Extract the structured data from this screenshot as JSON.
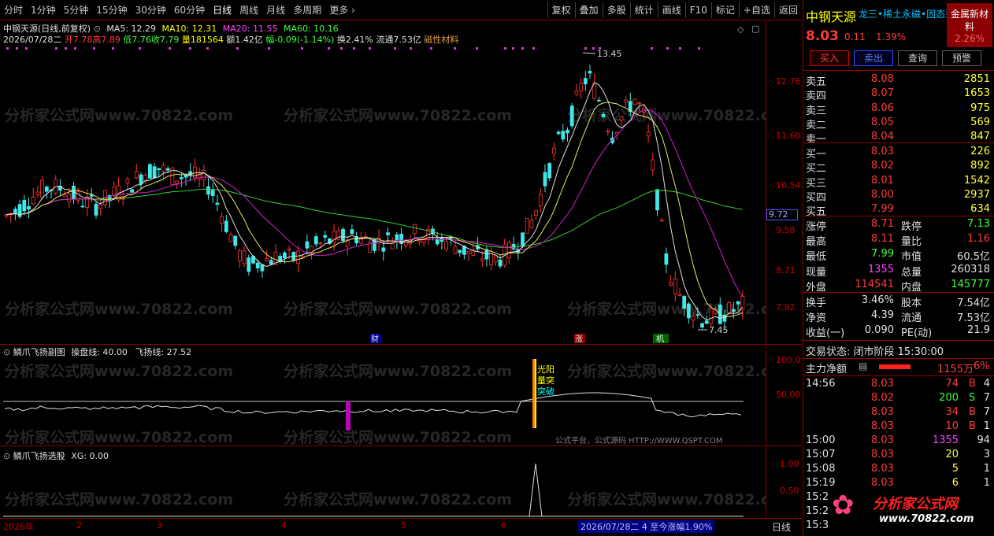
{
  "toolbar": {
    "periods": [
      "分时",
      "1分钟",
      "5分钟",
      "15分钟",
      "30分钟",
      "60分钟",
      "日线",
      "周线",
      "月线",
      "多周期",
      "更多"
    ],
    "active_period": "日线",
    "buttons": [
      "复权",
      "叠加",
      "多股",
      "统计",
      "画线",
      "F10",
      "标记",
      "+自选",
      "返回"
    ]
  },
  "main_chart": {
    "title": "中钢天源(日线,前复权)",
    "ma5": "MA5: 12.29",
    "ma10": "MA10: 12.31",
    "ma20": "MA20: 11.55",
    "ma60": "MA60: 10.16",
    "info_line": {
      "date": "2026/07/28二",
      "open": "开7.78",
      "high": "高7.89",
      "low": "低7.76",
      "close": "收7.79",
      "volume": "量181564",
      "amount": "额1.42亿",
      "change": "幅-0.09(-1.14%)",
      "turnover": "换2.41%",
      "float_cap": "流通7.53亿",
      "sector": "磁性材料"
    },
    "y_labels": [
      "12.76",
      "11.60",
      "10.54",
      "9.58",
      "8.71",
      "7.92"
    ],
    "current_price_tag": "9.72",
    "high_mark": "13.45",
    "low_mark": "7.45",
    "markers": [
      "财",
      "涨",
      "机"
    ]
  },
  "sub_chart1": {
    "title": "鳞爪飞扬副图",
    "line1": "操盘线: 40.00",
    "line2": "飞扬线: 27.52",
    "y_labels": [
      "100.0",
      "50.00"
    ],
    "annotation_lines": [
      "光阳",
      "量突",
      "突破"
    ],
    "footer_text": "公式平台，公式源码 HTTP://WWW.QSPT.COM"
  },
  "sub_chart2": {
    "title": "鳞爪飞扬选股",
    "xg": "XG: 0.00",
    "y_labels": [
      "1.00",
      "0.50"
    ]
  },
  "x_axis": {
    "labels": [
      "2026年",
      "2",
      "3",
      "4",
      "5",
      "6"
    ],
    "status": "2026/07/28二 4 至今涨幅1.90%",
    "period": "日线"
  },
  "watermark": "分析家公式网www.70822.com",
  "right_panel": {
    "stock_name": "中钢天源",
    "ticker_scroll": "龙三•稀土永磁•固态到",
    "industry": "金属新材料",
    "industry_change": "2.26%",
    "price": "8.03",
    "change": "0.11",
    "change_pct": "1.39%",
    "actions": [
      "买入",
      "卖出",
      "查询",
      "预警"
    ],
    "asks": [
      {
        "label": "卖五",
        "price": "8.08",
        "vol": "2851"
      },
      {
        "label": "卖四",
        "price": "8.07",
        "vol": "1653"
      },
      {
        "label": "卖三",
        "price": "8.06",
        "vol": "975"
      },
      {
        "label": "卖二",
        "price": "8.05",
        "vol": "569"
      },
      {
        "label": "卖一",
        "price": "8.04",
        "vol": "847"
      }
    ],
    "bids": [
      {
        "label": "买一",
        "price": "8.03",
        "vol": "226"
      },
      {
        "label": "买二",
        "price": "8.02",
        "vol": "892"
      },
      {
        "label": "买三",
        "price": "8.01",
        "vol": "1542"
      },
      {
        "label": "买四",
        "price": "8.00",
        "vol": "2937"
      },
      {
        "label": "买五",
        "price": "7.99",
        "vol": "634"
      }
    ],
    "stats": [
      {
        "l1": "涨停",
        "v1": "8.71",
        "l2": "跌停",
        "v2": "7.13"
      },
      {
        "l1": "最高",
        "v1": "8.11",
        "l2": "量比",
        "v2": "1.16"
      },
      {
        "l1": "最低",
        "v1": "7.99",
        "l2": "市值",
        "v2": "60.5亿"
      },
      {
        "l1": "现量",
        "v1": "1355",
        "l2": "总量",
        "v2": "260318"
      },
      {
        "l1": "外盘",
        "v1": "114541",
        "l2": "内盘",
        "v2": "145777"
      }
    ],
    "stats2": [
      {
        "l1": "换手",
        "v1": "3.46%",
        "l2": "股本",
        "v2": "7.54亿"
      },
      {
        "l1": "净资",
        "v1": "4.39",
        "l2": "流通",
        "v2": "7.53亿"
      },
      {
        "l1": "收益(一)",
        "v1": "0.090",
        "l2": "PE(动)",
        "v2": "21.9"
      }
    ],
    "trade_status": "交易状态: 闭市阶段 15:30:00",
    "main_net_label": "主力净额",
    "main_net_value": "1155万",
    "main_net_pct": "6%",
    "ticks": [
      {
        "time": "14:56",
        "price": "8.03",
        "vol": "74",
        "bs": "B",
        "n": "4"
      },
      {
        "time": "",
        "price": "8.02",
        "vol": "200",
        "bs": "S",
        "n": "7"
      },
      {
        "time": "",
        "price": "8.03",
        "vol": "34",
        "bs": "B",
        "n": "7"
      },
      {
        "time": "",
        "price": "8.03",
        "vol": "10",
        "bs": "B",
        "n": "1"
      },
      {
        "time": "15:00",
        "price": "8.03",
        "vol": "1355",
        "bs": "",
        "n": "94"
      },
      {
        "time": "15:07",
        "price": "8.03",
        "vol": "20",
        "bs": "",
        "n": "3"
      },
      {
        "time": "15:08",
        "price": "8.03",
        "vol": "5",
        "bs": "",
        "n": "1"
      },
      {
        "time": "15:19",
        "price": "8.03",
        "vol": "6",
        "bs": "",
        "n": "1"
      },
      {
        "time": "15:2",
        "price": "",
        "vol": "",
        "bs": "",
        "n": ""
      },
      {
        "time": "15:2",
        "price": "",
        "vol": "",
        "bs": "",
        "n": ""
      },
      {
        "time": "15:3",
        "price": "",
        "vol": "",
        "bs": "",
        "n": ""
      }
    ],
    "logo_text": "分析家公式网",
    "logo_url": "www.70822.com"
  }
}
